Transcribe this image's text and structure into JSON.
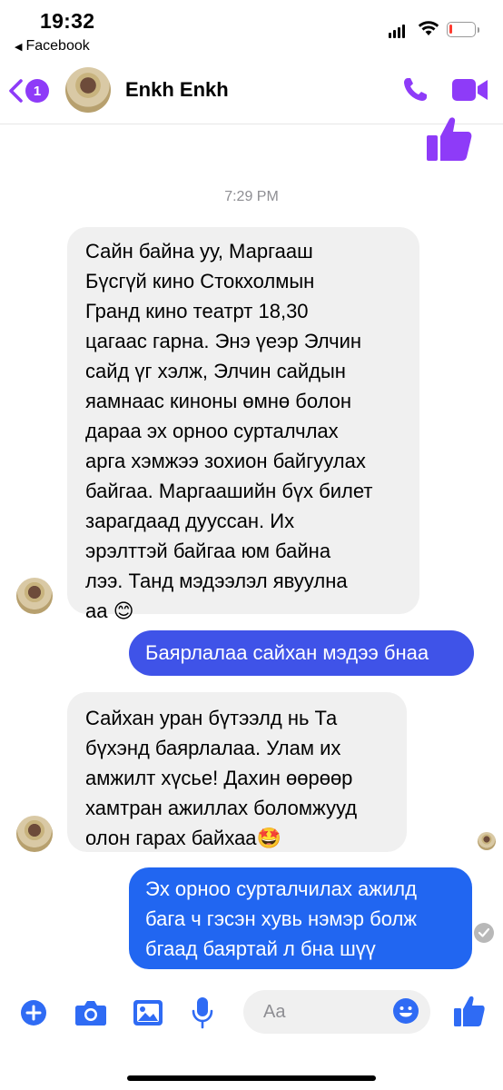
{
  "status_bar": {
    "time": "19:32",
    "back_app_label": "Facebook",
    "battery_level": 0.12
  },
  "header": {
    "unread_count": "1",
    "contact_name": "Enkh Enkh",
    "accent_color": "#8e3bf8"
  },
  "conversation": {
    "timestamp": "7:29 PM",
    "messages": [
      {
        "direction": "incoming",
        "text": "Сайн байна уу, Маргааш\nБүсгүй кино Стокхолмын\nГранд кино театрт 18,30\nцагаас гарна. Энэ үеэр Элчин\nсайд үг хэлж, Элчин сайдын\nяамнаас киноны өмнө болон\nдараа эх орноо сурталчлах\nарга хэмжээ зохион байгуулах\nбайгаа. Маргаашийн бүх билет\nзарагдаад дууссан. Их\nэрэлттэй байгаа юм байна\nлээ.  Танд мэдээлэл явуулна\nаа 😊"
      },
      {
        "direction": "outgoing",
        "text": "Баярлалаа сайхан мэдээ бнаа",
        "color": "#3f53e8"
      },
      {
        "direction": "incoming",
        "text": "Сайхан уран бүтээлд нь Та\nбүхэнд баярлалаа. Улам их\nамжилт хүсье! Дахин өөрөөр\nхамтран ажиллах боломжууд\nолон гарах байхаа🤩"
      },
      {
        "direction": "outgoing",
        "text": "Эх орноо сурталчилах ажилд\nбага ч гэсэн хувь нэмэр болж\nбгаад баяртай л бна шүү",
        "color": "#2166f1"
      }
    ]
  },
  "composer": {
    "placeholder": "Aa",
    "icons": [
      "plus-icon",
      "camera-icon",
      "image-icon",
      "microphone-icon",
      "emoji-icon",
      "thumbs-up-icon"
    ],
    "icon_color": "#2f6bf4"
  },
  "colors": {
    "incoming_bubble": "#f0f0f0",
    "outgoing_bubble_top": "#3f53e8",
    "outgoing_bubble_bottom": "#2166f1",
    "header_purple": "#8e3bf8"
  }
}
